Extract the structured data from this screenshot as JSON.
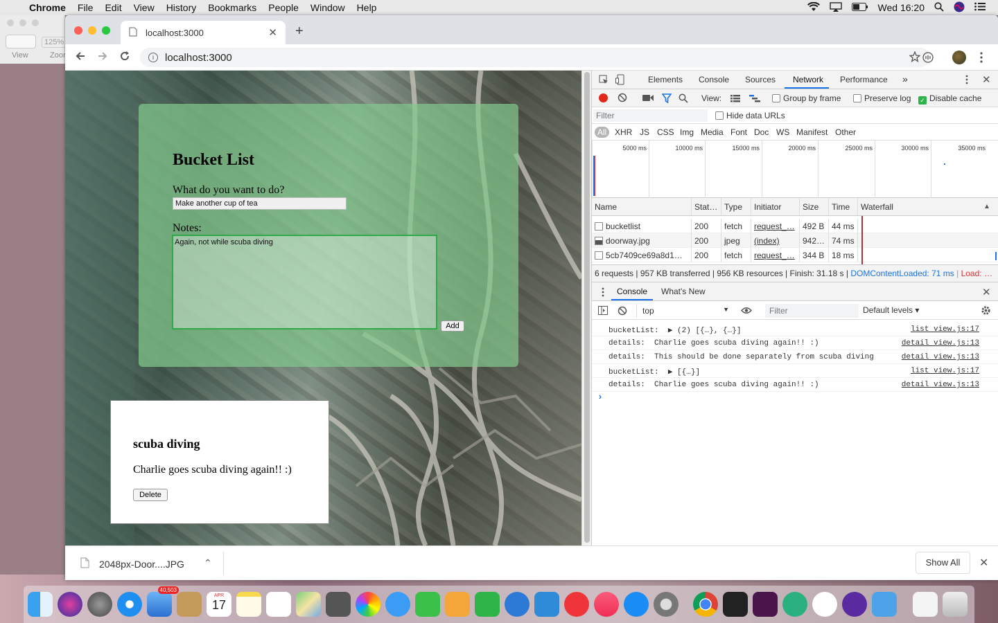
{
  "menubar": {
    "app": "Chrome",
    "items": [
      "File",
      "Edit",
      "View",
      "History",
      "Bookmarks",
      "People",
      "Window",
      "Help"
    ],
    "clock": "Wed 16:20"
  },
  "bg_window": {
    "zoom": "125%",
    "view_label": "View",
    "zoom_label": "Zoom"
  },
  "browser": {
    "tab_title": "localhost:3000",
    "url": "localhost:3000"
  },
  "page": {
    "form": {
      "title": "Bucket List",
      "question": "What do you want to do?",
      "what_value": "Make another cup of tea",
      "notes_label": "Notes:",
      "notes_value": "Again, not while scuba diving",
      "add_label": "Add"
    },
    "item": {
      "title": "scuba diving",
      "details": "Charlie goes scuba diving again!! :)",
      "delete_label": "Delete"
    }
  },
  "devtools": {
    "tabs": [
      "Elements",
      "Console",
      "Sources",
      "Network",
      "Performance"
    ],
    "active_tab": "Network",
    "more": "»",
    "net_view_label": "View:",
    "group_by_frame": "Group by frame",
    "preserve_log": "Preserve log",
    "disable_cache": "Disable cache",
    "filter_placeholder": "Filter",
    "hide_data_urls": "Hide data URLs",
    "types": [
      "All",
      "XHR",
      "JS",
      "CSS",
      "Img",
      "Media",
      "Font",
      "Doc",
      "WS",
      "Manifest",
      "Other"
    ],
    "timeline_ticks": [
      "5000 ms",
      "10000 ms",
      "15000 ms",
      "20000 ms",
      "25000 ms",
      "30000 ms",
      "35000 ms"
    ],
    "columns": [
      "Name",
      "Stat…",
      "Type",
      "Initiator",
      "Size",
      "Time",
      "Waterfall"
    ],
    "rows": [
      {
        "name": "bucketlist",
        "status": "200",
        "type": "fetch",
        "initiator": "request_…",
        "size": "492 B",
        "time": "44 ms"
      },
      {
        "name": "doorway.jpg",
        "status": "200",
        "type": "jpeg",
        "initiator": "(index)",
        "size": "942…",
        "time": "74 ms"
      },
      {
        "name": "5cb7409ce69a8d1…",
        "status": "200",
        "type": "fetch",
        "initiator": "request_…",
        "size": "344 B",
        "time": "18 ms"
      }
    ],
    "summary": {
      "main": "6 requests | 957 KB transferred | 956 KB resources | Finish: 31.18 s |",
      "dcl": "DOMContentLoaded: 71 ms",
      "load": "Load: …"
    },
    "drawer_tabs": [
      "Console",
      "What's New"
    ],
    "context": "top",
    "console_filter": "Filter",
    "levels": "Default levels ▾",
    "logs": [
      {
        "text": "bucketList:  ▶ (2) [{…}, {…}]",
        "src": "list view.js:17"
      },
      {
        "text": "details:  Charlie goes scuba diving again!! :)",
        "src": "detail view.js:13"
      },
      {
        "text": "details:  This should be done separately from scuba diving",
        "src": "detail view.js:13"
      },
      {
        "text": "bucketList:  ▶ [{…}]",
        "src": "list view.js:17"
      },
      {
        "text": "details:  Charlie goes scuba diving again!! :)",
        "src": "detail view.js:13"
      }
    ],
    "prompt": "›"
  },
  "download": {
    "file": "2048px-Door....JPG",
    "show_all": "Show All"
  },
  "dock": {
    "calendar_month": "APR",
    "calendar_day": "17",
    "mail_badge": "40,503"
  }
}
